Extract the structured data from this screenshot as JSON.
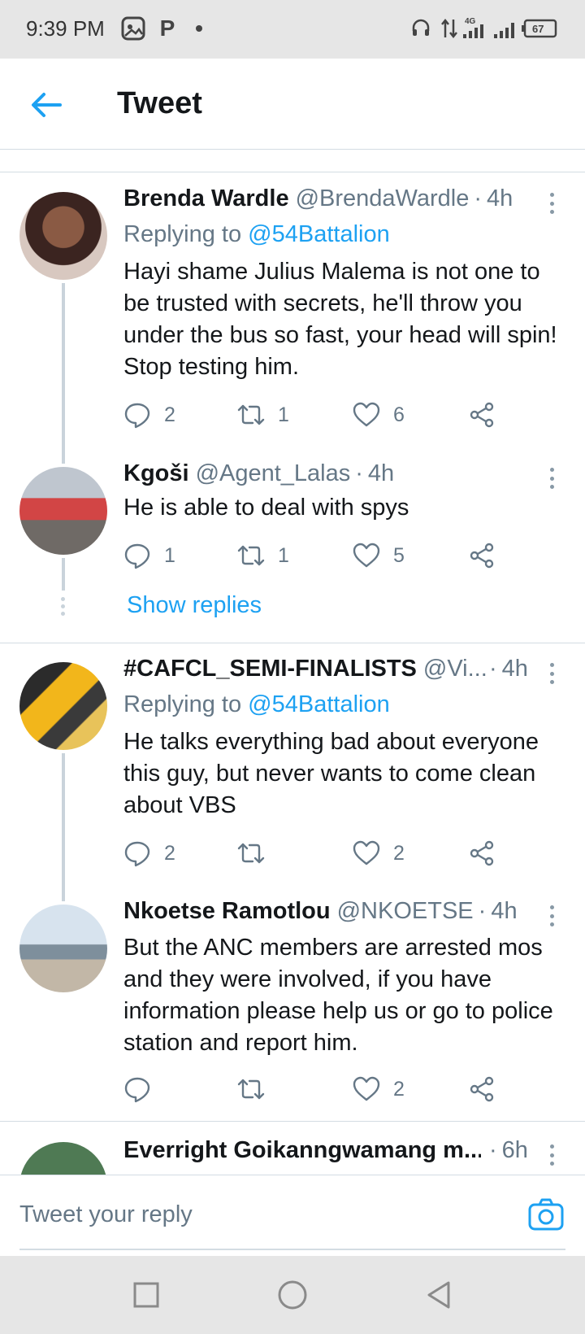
{
  "status_bar": {
    "time": "9:39 PM",
    "left_icons": [
      "gallery-app-icon",
      "parking-app-icon",
      "notification-dot-icon"
    ],
    "right_icons": [
      "headset-icon",
      "data-transfer-icon",
      "signal-4g-icon",
      "signal-icon"
    ],
    "network_label": "4G",
    "battery": "67"
  },
  "app_bar": {
    "back_icon": "arrow-left-icon",
    "title": "Tweet"
  },
  "tweets": [
    {
      "name": "Brenda Wardle",
      "handle": "@BrendaWardle",
      "time": "4h",
      "replying_prefix": "Replying to ",
      "replying_to": "@54Battalion",
      "text": "Hayi shame Julius Malema is not one to be trusted with secrets, he'll throw you under the bus so fast, your head will spin! Stop testing him.",
      "replies": "2",
      "retweets": "1",
      "likes": "6"
    },
    {
      "name": "Kgoši",
      "handle": "@Agent_Lalas",
      "time": "4h",
      "text": "He is able to deal with spys",
      "replies": "1",
      "retweets": "1",
      "likes": "5"
    },
    {
      "name": "#CAFCL_SEMI-FINALISTS",
      "handle": "@Vi...",
      "time": "4h",
      "replying_prefix": "Replying to ",
      "replying_to": "@54Battalion",
      "text": "He talks everything bad about everyone this guy, but never wants to come clean about VBS",
      "replies": "2",
      "retweets": "",
      "likes": "2"
    },
    {
      "name": "Nkoetse Ramotlou",
      "handle": "@NKOETSE",
      "time": "4h",
      "text": "But the ANC members are arrested mos and they were involved, if you have information please help us or go to police station and report him.",
      "replies": "",
      "retweets": "",
      "likes": "2"
    },
    {
      "name": "Everright Goikanngwamang m...",
      "handle": "",
      "time": "6h"
    }
  ],
  "show_replies": "Show replies",
  "reply_bar": {
    "placeholder": "Tweet your reply",
    "camera_icon": "camera-icon"
  },
  "nav_bar": {
    "icons": [
      "recents-square-icon",
      "home-circle-icon",
      "back-triangle-icon"
    ]
  },
  "colors": {
    "accent": "#1da1f2",
    "text_primary": "#14171a",
    "text_secondary": "#657786",
    "divider": "#d3dce3"
  }
}
